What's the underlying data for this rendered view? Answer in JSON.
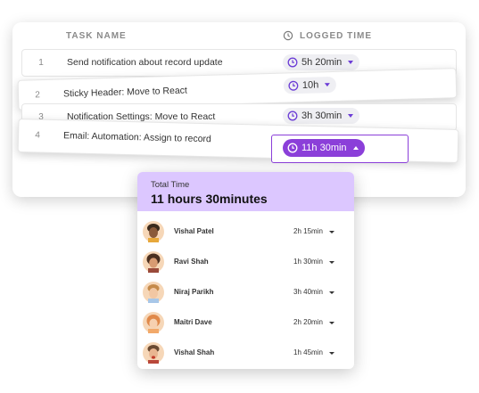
{
  "table": {
    "col_task": "TASK NAME",
    "col_time": "LOGGED TIME",
    "rows": [
      {
        "num": "1",
        "name": "Send notification about record update",
        "time": "5h 20min"
      },
      {
        "num": "2",
        "name": "Sticky Header: Move to React",
        "time": "10h"
      },
      {
        "num": "3",
        "name": "Notification Settings: Move to React",
        "time": "3h 30min"
      },
      {
        "num": "4",
        "name": "Email: Automation: Assign to record",
        "time": "11h 30min"
      }
    ]
  },
  "popup": {
    "label": "Total Time",
    "total": "11 hours 30minutes",
    "users": [
      {
        "name": "Vishal Patel",
        "time": "2h 15min"
      },
      {
        "name": "Ravi Shah",
        "time": "1h 30min"
      },
      {
        "name": "Niraj Parikh",
        "time": "3h 40min"
      },
      {
        "name": "Maitri Dave",
        "time": "2h 20min"
      },
      {
        "name": "Vishal Shah",
        "time": "1h 45min"
      }
    ]
  },
  "colors": {
    "accent": "#8b3fd9",
    "popup_header": "#dcc7ff"
  }
}
